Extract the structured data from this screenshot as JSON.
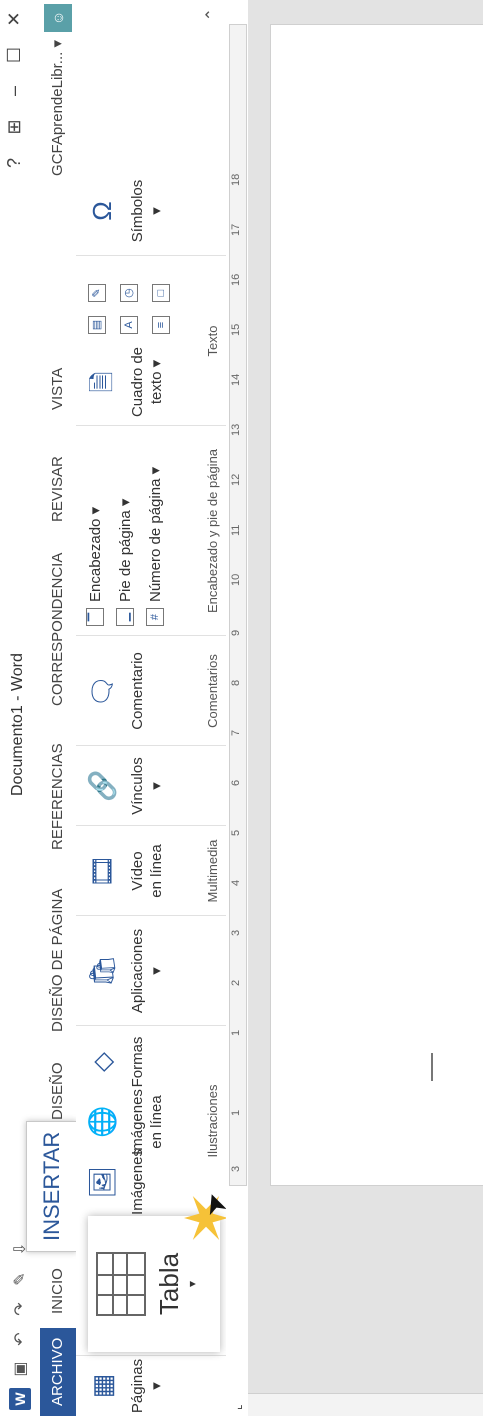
{
  "window": {
    "title": "Documento1 - Word",
    "controls": [
      "?",
      "⊞",
      "–",
      "☐",
      "✕"
    ]
  },
  "qat": {
    "icons": [
      "word-icon",
      "save-icon",
      "undo-icon",
      "redo-icon",
      "format-painter-icon",
      "customize-icon"
    ]
  },
  "tabs": [
    {
      "label": "ARCHIVO"
    },
    {
      "label": "INICIO"
    },
    {
      "label": "INSERTAR"
    },
    {
      "label": "DISEÑO"
    },
    {
      "label": "DISEÑO DE PÁGINA"
    },
    {
      "label": "REFERENCIAS"
    },
    {
      "label": "CORRESPONDENCIA"
    },
    {
      "label": "REVISAR"
    },
    {
      "label": "VISTA"
    }
  ],
  "user": {
    "name": "GCFAprendeLibr...",
    "arrow": "▾"
  },
  "ribbon": {
    "paginas": {
      "label": "Páginas",
      "arrow": "▾"
    },
    "tabla": {
      "label": "Tabla",
      "arrow": "▾"
    },
    "ilustraciones": {
      "imagenes": "Imágenes",
      "imagenes_linea_1": "Imágenes",
      "imagenes_linea_2": "en línea",
      "formas": "Formas",
      "group": "Ilustraciones"
    },
    "aplicaciones": {
      "label": "Aplicaciones",
      "arrow": "▾"
    },
    "multimedia": {
      "line1": "Vídeo",
      "line2": "en línea",
      "group": "Multimedia"
    },
    "vinculos": {
      "label": "Vínculos",
      "arrow": "▾"
    },
    "comentarios": {
      "label": "Comentario",
      "group": "Comentarios"
    },
    "encabezado": {
      "encabezado": "Encabezado ▾",
      "pie": "Pie de página ▾",
      "numero": "Número de página ▾",
      "group": "Encabezado y pie de página"
    },
    "texto": {
      "cuadro1": "Cuadro de",
      "cuadro2": "texto ▾",
      "group": "Texto"
    },
    "simbolos": {
      "label": "Símbolos",
      "arrow": "▾"
    }
  },
  "ruler": {
    "ticks": [
      "3",
      "1",
      "1",
      "2",
      "3",
      "4",
      "5",
      "6",
      "7",
      "8",
      "9",
      "10",
      "11",
      "12",
      "13",
      "14",
      "15",
      "16",
      "17",
      "18"
    ]
  }
}
